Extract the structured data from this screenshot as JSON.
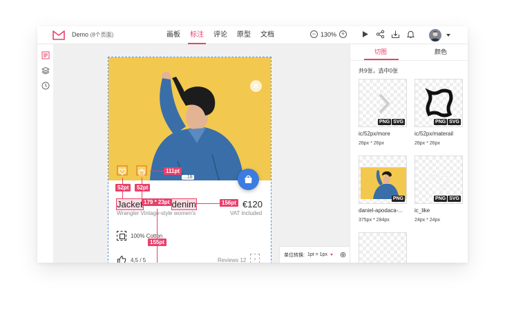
{
  "header": {
    "project_name": "Demo",
    "page_count": "(8个页面)",
    "nav": [
      {
        "label": "画板",
        "active": false
      },
      {
        "label": "标注",
        "active": true
      },
      {
        "label": "评论",
        "active": false
      },
      {
        "label": "原型",
        "active": false
      },
      {
        "label": "文档",
        "active": false
      }
    ],
    "zoom_out": "−",
    "zoom_level": "130%",
    "zoom_in": "+",
    "tools": [
      "play-icon",
      "share-icon",
      "download-icon",
      "bell-icon"
    ],
    "accent": "#e8416b"
  },
  "left_rail": [
    "annotation-icon",
    "layers-icon",
    "history-icon"
  ],
  "canvas": {
    "product": {
      "title_pre": "Jacket",
      "title_post": "denim",
      "price": "€120",
      "subtitle": "Wrangler Vintage-style women's",
      "vat": "VAT included",
      "feature": "100% Cotton",
      "rating": "4,5 / 5",
      "reviews": "Reviews 12",
      "reviews_arrow": "›",
      "size_hint": "...18"
    },
    "close_glyph": "✕",
    "measurements": {
      "m1": "111pt",
      "m2": "52pt",
      "m3": "52pt",
      "m4": "179 * 23pt",
      "m5": "156pt",
      "m6": "155pt"
    },
    "unit_label": "单位转换:",
    "unit_value": "1pt = 1px"
  },
  "right_panel": {
    "tabs": [
      {
        "label": "切图",
        "active": true
      },
      {
        "label": "颜色",
        "active": false
      }
    ],
    "count": "共9张，选中0张",
    "assets": [
      {
        "name": "ic/52px/more",
        "size": "26px * 26px",
        "badges": [
          "PNG",
          "SVG"
        ]
      },
      {
        "name": "ic/52px/materail",
        "size": "26px * 26px",
        "badges": [
          "PNG",
          "SVG"
        ]
      },
      {
        "name": "daniel-apodaca-...",
        "size": "375px * 284px",
        "badges": [
          "PNG"
        ]
      },
      {
        "name": "ic_like",
        "size": "24px * 24px",
        "badges": [
          "PNG",
          "SVG"
        ]
      }
    ]
  }
}
